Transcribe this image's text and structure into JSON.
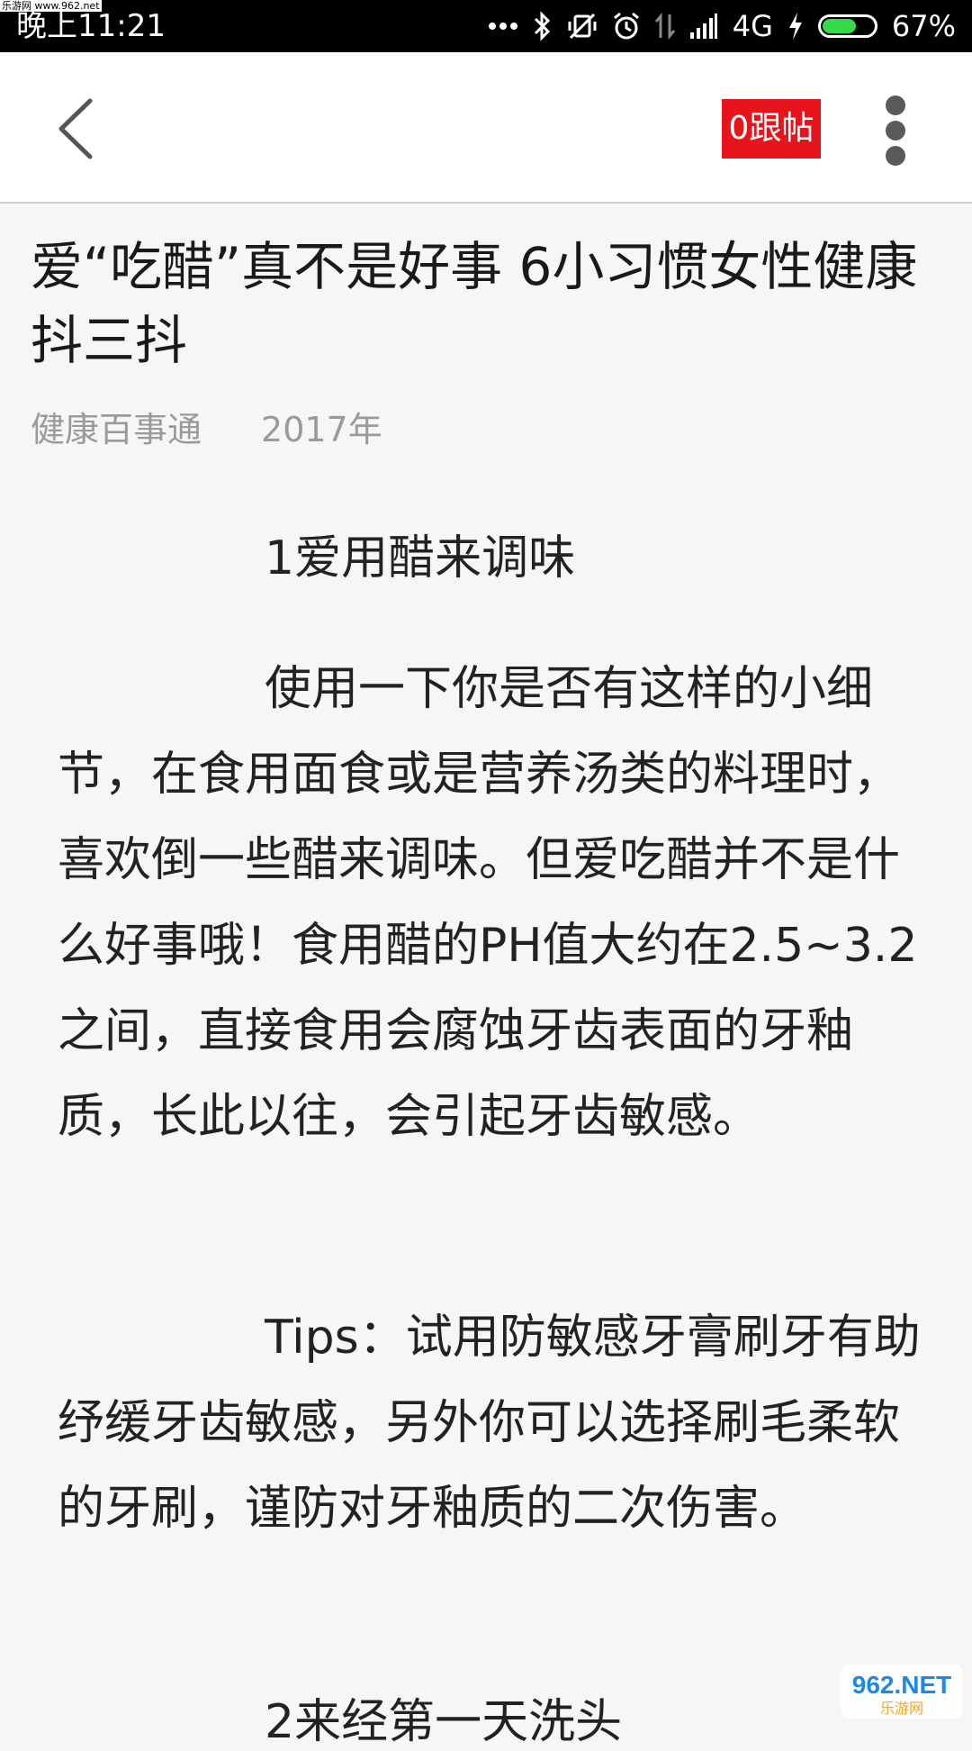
{
  "watermark": {
    "top_text": "乐游网 www.962.net",
    "bottom_logo": "962.NET",
    "bottom_sub": "乐游网"
  },
  "status_bar": {
    "time": "晚上11:21",
    "network": "4G",
    "battery_percent": "67%",
    "battery_level": 0.67,
    "icons": [
      "more-dots-icon",
      "bluetooth-icon",
      "mute-vibrate-icon",
      "alarm-icon",
      "data-transfer-icon",
      "signal-icon",
      "charging-icon",
      "battery-icon"
    ]
  },
  "app_bar": {
    "reply_count_label": "0跟帖",
    "back_icon": "chevron-left-icon",
    "more_icon": "vertical-dots-icon"
  },
  "article": {
    "title": "爱“吃醋”真不是好事 6小习惯女性健康抖三抖",
    "source": "健康百事通",
    "date": "2017年",
    "sections": [
      {
        "heading": "1爱用醋来调味"
      },
      {
        "paragraph": "使用一下你是否有这样的小细节，在食用面食或是营养汤类的料理时，喜欢倒一些醋来调味。但爱吃醋并不是什么好事哦！食用醋的PH值大约在2.5~3.2之间，直接食用会腐蚀牙齿表面的牙釉质，长此以往，会引起牙齿敏感。"
      },
      {
        "paragraph": "Tips：试用防敏感牙膏刷牙有助纾缓牙齿敏感，另外你可以选择刷毛柔软的牙刷，谨防对牙釉质的二次伤害。"
      },
      {
        "heading": "2来经第一天洗头"
      }
    ]
  },
  "colors": {
    "status_bar_bg": "#000000",
    "app_bar_bg": "#ffffff",
    "page_bg": "#f6f6f6",
    "accent_red": "#e8141b",
    "meta_gray": "#9a9a9a",
    "battery_green": "#35d94a"
  }
}
